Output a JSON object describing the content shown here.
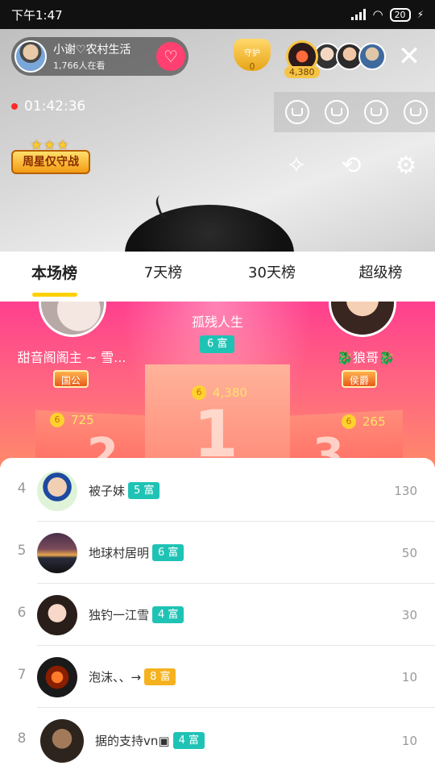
{
  "status_bar": {
    "time": "下午1:47",
    "battery": "20"
  },
  "host": {
    "name": "小谢♡农村生活",
    "watching": "1,766人在看"
  },
  "guard": {
    "label": "守护",
    "count": "0"
  },
  "fans": {
    "top_value": "4,380"
  },
  "live_timer": "01:42:36",
  "weekly_battle": {
    "label": "周星仅守战"
  },
  "tabs": [
    "本场榜",
    "7天榜",
    "30天榜",
    "超级榜"
  ],
  "podium": {
    "first": {
      "name": "孤残人生",
      "level": "6 富",
      "score": "4,380"
    },
    "second": {
      "name": "甜音阁阁主 ~ 雪...",
      "badge": "国公",
      "score": "725"
    },
    "third": {
      "name": "🐉狼哥🐉",
      "badge": "侯爵",
      "score": "265"
    },
    "coin_symbol": "6"
  },
  "ranking": [
    {
      "rank": "4",
      "name": "被子妹",
      "level": "5 富",
      "level_color": "#1fc3b5",
      "score": "130"
    },
    {
      "rank": "5",
      "name": "地球村居明",
      "level": "6 富",
      "level_color": "#1fc3b5",
      "score": "50"
    },
    {
      "rank": "6",
      "name": "独钓一江雪",
      "level": "4 富",
      "level_color": "#1fc3b5",
      "score": "30"
    },
    {
      "rank": "7",
      "name": "泡沫、、→",
      "level": "8 富",
      "level_color": "#f5b21e",
      "score": "10"
    },
    {
      "rank": "8",
      "name": "据的支持vn▣",
      "level": "4 富",
      "level_color": "#1fc3b5",
      "score": "10"
    }
  ]
}
